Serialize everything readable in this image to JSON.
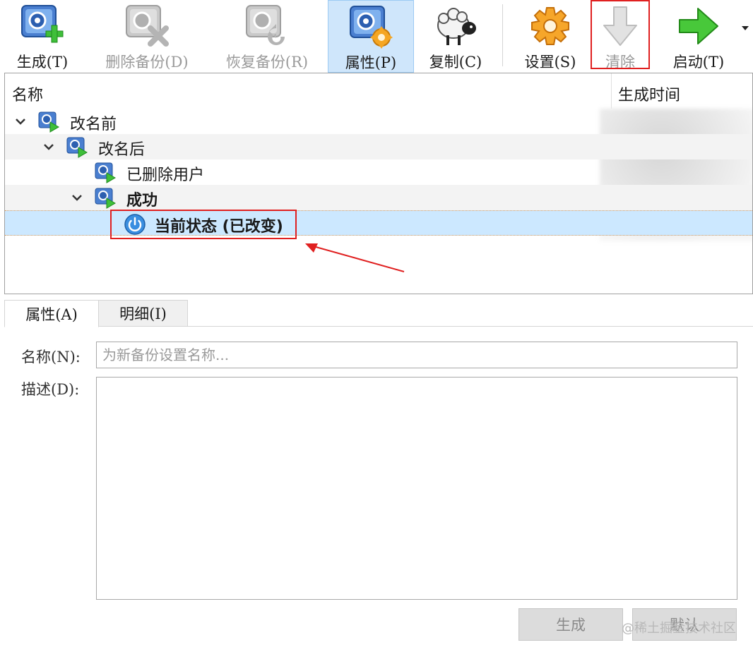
{
  "toolbar": {
    "buttons": [
      {
        "id": "create",
        "label": "生成(T)",
        "icon": "snapshot-add-icon"
      },
      {
        "id": "delete",
        "label": "删除备份(D)",
        "icon": "snapshot-delete-icon"
      },
      {
        "id": "restore",
        "label": "恢复备份(R)",
        "icon": "snapshot-restore-icon"
      },
      {
        "id": "properties",
        "label": "属性(P)",
        "icon": "snapshot-settings-icon"
      },
      {
        "id": "clone",
        "label": "复制(C)",
        "icon": "sheep-clone-icon"
      },
      {
        "id": "settings",
        "label": "设置(S)",
        "icon": "gear-icon"
      },
      {
        "id": "discard",
        "label": "清除",
        "icon": "down-arrow-icon"
      },
      {
        "id": "start",
        "label": "启动(T)",
        "icon": "green-arrow-icon"
      }
    ]
  },
  "tree": {
    "col_name": "名称",
    "col_time": "生成时间",
    "nodes": [
      {
        "label": "改名前"
      },
      {
        "label": "改名后"
      },
      {
        "label": "已删除用户"
      },
      {
        "label": "成功"
      },
      {
        "label": "当前状态 (已改变)"
      }
    ]
  },
  "tabs": {
    "attributes": "属性(A)",
    "details": "明细(I)"
  },
  "form": {
    "name_label": "名称(N):",
    "name_placeholder": "为新备份设置名称...",
    "name_value": "",
    "desc_label": "描述(D):",
    "desc_value": ""
  },
  "actions": {
    "create": "生成",
    "reset": "默认"
  },
  "watermark": "@稀土掘金技术社区",
  "colors": {
    "selection": "#cce8ff",
    "annotation": "#e02020",
    "active_toolbar": "#cfe6fb"
  }
}
